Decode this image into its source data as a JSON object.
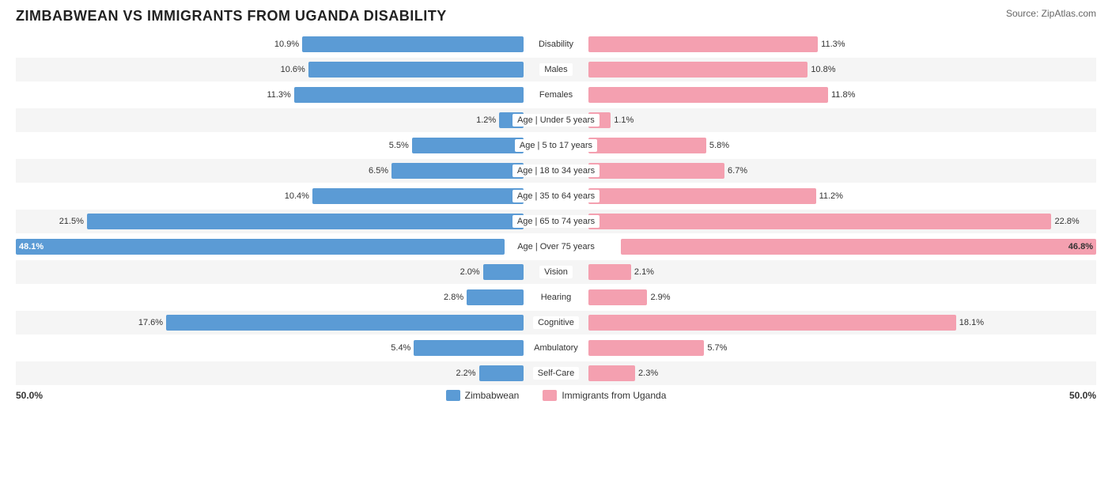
{
  "title": "ZIMBABWEAN VS IMMIGRANTS FROM UGANDA DISABILITY",
  "source": "Source: ZipAtlas.com",
  "scale": {
    "left": "50.0%",
    "right": "50.0%"
  },
  "legend": {
    "zimbabwean_label": "Zimbabwean",
    "uganda_label": "Immigrants from Uganda",
    "zimbabwean_color": "#5b9bd5",
    "uganda_color": "#f4a0b0"
  },
  "rows": [
    {
      "label": "Disability",
      "left_val": "10.9%",
      "left_pct": 21.8,
      "right_val": "11.3%",
      "right_pct": 22.6,
      "shaded": false
    },
    {
      "label": "Males",
      "left_val": "10.6%",
      "left_pct": 21.2,
      "right_val": "10.8%",
      "right_pct": 21.6,
      "shaded": true
    },
    {
      "label": "Females",
      "left_val": "11.3%",
      "left_pct": 22.6,
      "right_val": "11.8%",
      "right_pct": 23.6,
      "shaded": false
    },
    {
      "label": "Age | Under 5 years",
      "left_val": "1.2%",
      "left_pct": 2.4,
      "right_val": "1.1%",
      "right_pct": 2.2,
      "shaded": true
    },
    {
      "label": "Age | 5 to 17 years",
      "left_val": "5.5%",
      "left_pct": 11.0,
      "right_val": "5.8%",
      "right_pct": 11.6,
      "shaded": false
    },
    {
      "label": "Age | 18 to 34 years",
      "left_val": "6.5%",
      "left_pct": 13.0,
      "right_val": "6.7%",
      "right_pct": 13.4,
      "shaded": true
    },
    {
      "label": "Age | 35 to 64 years",
      "left_val": "10.4%",
      "left_pct": 20.8,
      "right_val": "11.2%",
      "right_pct": 22.4,
      "shaded": false
    },
    {
      "label": "Age | 65 to 74 years",
      "left_val": "21.5%",
      "left_pct": 43.0,
      "right_val": "22.8%",
      "right_pct": 45.6,
      "shaded": true
    },
    {
      "label": "Age | Over 75 years",
      "left_val": "48.1%",
      "left_pct": 96.2,
      "right_val": "46.8%",
      "right_pct": 93.6,
      "shaded": false,
      "special": true
    },
    {
      "label": "Vision",
      "left_val": "2.0%",
      "left_pct": 4.0,
      "right_val": "2.1%",
      "right_pct": 4.2,
      "shaded": true
    },
    {
      "label": "Hearing",
      "left_val": "2.8%",
      "left_pct": 5.6,
      "right_val": "2.9%",
      "right_pct": 5.8,
      "shaded": false
    },
    {
      "label": "Cognitive",
      "left_val": "17.6%",
      "left_pct": 35.2,
      "right_val": "18.1%",
      "right_pct": 36.2,
      "shaded": true
    },
    {
      "label": "Ambulatory",
      "left_val": "5.4%",
      "left_pct": 10.8,
      "right_val": "5.7%",
      "right_pct": 11.4,
      "shaded": false
    },
    {
      "label": "Self-Care",
      "left_val": "2.2%",
      "left_pct": 4.4,
      "right_val": "2.3%",
      "right_pct": 4.6,
      "shaded": true
    }
  ]
}
